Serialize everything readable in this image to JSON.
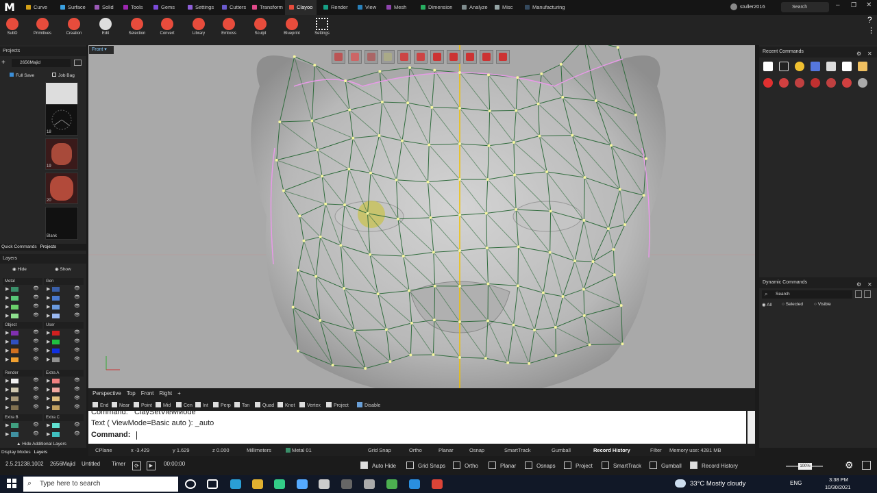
{
  "app": {
    "logo": "M"
  },
  "menu_tabs": [
    {
      "label": "Curve",
      "color": "#d4a017"
    },
    {
      "label": "Surface",
      "color": "#3aa0e0"
    },
    {
      "label": "Solid",
      "color": "#9b59b6"
    },
    {
      "label": "Tools",
      "color": "#9c27b0"
    },
    {
      "label": "Gems",
      "color": "#7b4bd8"
    },
    {
      "label": "Settings",
      "color": "#8e5fd8"
    },
    {
      "label": "Cutters",
      "color": "#6a5acd"
    },
    {
      "label": "Transform",
      "color": "#e04a8a"
    },
    {
      "label": "Clayoo",
      "color": "#e74c3c"
    },
    {
      "label": "Render",
      "color": "#16a085"
    },
    {
      "label": "View",
      "color": "#2980b9"
    },
    {
      "label": "Mesh",
      "color": "#8e44ad"
    },
    {
      "label": "Dimension",
      "color": "#27ae60"
    },
    {
      "label": "Analyze",
      "color": "#7f8c8d"
    },
    {
      "label": "Misc",
      "color": "#95a5a6"
    },
    {
      "label": "Manufacturing",
      "color": "#34495e"
    }
  ],
  "user": "stuller2016",
  "search_label": "Search",
  "ribbon": [
    "SubD",
    "Primitives",
    "Creation",
    "Edit",
    "Selection",
    "Convert",
    "Library",
    "Emboss",
    "Sculpt",
    "Blueprint",
    "Settings"
  ],
  "projects": {
    "title": "Projects",
    "project_name": "2656Majid",
    "full_save": "Full Save",
    "job_bag": "Job Bag",
    "thumbs": [
      "17",
      "18",
      "19",
      "20",
      "Blank"
    ],
    "tab_quick": "Quick Commands",
    "tab_projects": "Projects"
  },
  "layers": {
    "title": "Layers",
    "hide": "Hide",
    "show": "Show",
    "groups": [
      "Metal",
      "Gen",
      "Object",
      "User",
      "Render",
      "Extra A",
      "Extra B",
      "Extra C"
    ],
    "hide_additional": "Hide Additional Layers",
    "tab_display": "Display Modes",
    "tab_layers": "Layers"
  },
  "viewport": {
    "name": "Front"
  },
  "recent": {
    "title": "Recent Commands"
  },
  "dynamic": {
    "title": "Dynamic Commands",
    "search": "Search",
    "all": "All",
    "selected": "Selected",
    "visible": "Visible"
  },
  "view_tabs": [
    "Perspective",
    "Top",
    "Front",
    "Right",
    "+"
  ],
  "osnaps": [
    "End",
    "Near",
    "Point",
    "Mid",
    "Cen",
    "Int",
    "Perp",
    "Tan",
    "Quad",
    "Knot",
    "Vertex",
    "Project",
    "Disable"
  ],
  "cmd": {
    "line1": "Command: _ClaySetViewMode",
    "line2": "Text ( ViewMode=Basic  auto ): _auto",
    "prompt": "Command:"
  },
  "status": {
    "cplane": "CPlane",
    "x": "x -3.429",
    "y": "y 1.629",
    "z": "z 0.000",
    "units": "Millimeters",
    "layer": "Metal 01",
    "grid_snap": "Grid Snap",
    "ortho": "Ortho",
    "planar": "Planar",
    "osnap": "Osnap",
    "smarttrack": "SmartTrack",
    "gumball": "Gumball",
    "record": "Record History",
    "filter": "Filter",
    "memory": "Memory use: 4281 MB"
  },
  "bottom": {
    "version": "2.5.21238.1002",
    "project": "2656Majid",
    "file": "Untitled",
    "timer": "Timer",
    "time": "00:00:00",
    "auto_hide": "Auto Hide",
    "grid_snaps": "Grid Snaps",
    "ortho": "Ortho",
    "planar": "Planar",
    "osnaps": "Osnaps",
    "project_lbl": "Project",
    "smarttrack": "SmartTrack",
    "gumball": "Gumball",
    "record": "Record History",
    "zoom": "100%"
  },
  "taskbar": {
    "search": "Type here to search",
    "weather": "33°C  Mostly cloudy",
    "lang": "ENG",
    "time": "3:38 PM",
    "date": "10/30/2021"
  }
}
